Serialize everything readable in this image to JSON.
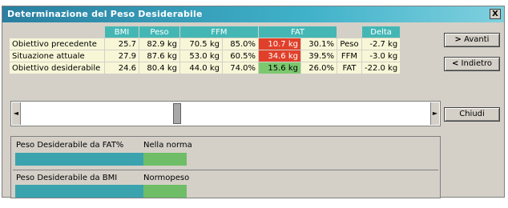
{
  "window": {
    "title": "Determinazione del Peso Desiderabile",
    "close_label": "X"
  },
  "table": {
    "headers": [
      "BMI",
      "Peso",
      "FFM",
      "FAT",
      "Delta"
    ],
    "rows": [
      {
        "label": "Obiettivo precedente",
        "bmi": "25.7",
        "peso": "82.9 kg",
        "ffm_kg": "70.5 kg",
        "ffm_pct": "85.0%",
        "fat_kg": "10.7 kg",
        "fat_pct": "30.1%",
        "delta_label": "Peso",
        "delta_val": "-2.7 kg"
      },
      {
        "label": "Situazione attuale",
        "bmi": "27.9",
        "peso": "87.6 kg",
        "ffm_kg": "53.0 kg",
        "ffm_pct": "60.5%",
        "fat_kg": "34.6 kg",
        "fat_pct": "39.5%",
        "delta_label": "FFM",
        "delta_val": "-3.0 kg"
      },
      {
        "label": "Obiettivo desiderabile",
        "bmi": "24.6",
        "peso": "80.4 kg",
        "ffm_kg": "44.0 kg",
        "ffm_pct": "74.0%",
        "fat_kg": "15.6 kg",
        "fat_pct": "26.0%",
        "delta_label": "FAT",
        "delta_val": "-22.0 kg"
      }
    ],
    "colors": {
      "header": "#44b7b5",
      "cell": "#f7f7d8",
      "fat_high": "#e0402a",
      "fat_ok": "#7cc86e"
    }
  },
  "buttons": {
    "avanti": "Avanti",
    "avanti_icon": ">",
    "indietro": "Indietro",
    "indietro_icon": "<",
    "chiudi": "Chiudi"
  },
  "panel": {
    "fat_label": "Peso Desiderabile da FAT%",
    "fat_status": "Nella norma",
    "fat_level": 0.7,
    "bmi_label": "Peso Desiderabile da BMI",
    "bmi_status": "Normopeso",
    "bmi_level": 0.7
  },
  "scroll": {
    "left_arrow": "◄",
    "right_arrow": "►"
  }
}
